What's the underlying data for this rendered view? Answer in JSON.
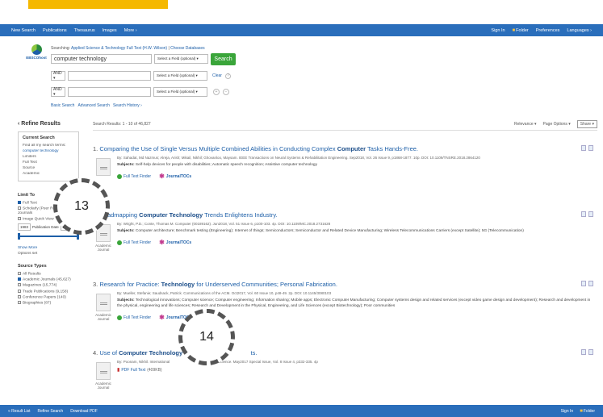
{
  "topbar": {
    "nav": [
      "New Search",
      "Publications",
      "Thesaurus",
      "Images",
      "More ›"
    ],
    "right": [
      "Sign In",
      "Folder",
      "Preferences",
      "Languages ›"
    ]
  },
  "logo_text": "EBSCOhost",
  "search": {
    "searching_label": "Searching:",
    "database": "Applied Science & Technology Full Text (H.W. Wilson)",
    "choose_db": "Choose Databases",
    "query": "computer technology",
    "field_select": "Select a Field (optional) ▾",
    "search_button": "Search",
    "bool2": "AND ▾",
    "bool3": "AND ▾",
    "clear": "Clear",
    "links": [
      "Basic Search",
      "Advanced Search",
      "Search History ›"
    ]
  },
  "sidebar": {
    "title": "Refine Results",
    "current_search": "Current Search",
    "find_all": "Find all my search terms:",
    "term": "computer technology",
    "limiters": "Limiters",
    "full_text": "Full Text",
    "source": "Source",
    "academic": "Academic",
    "limit_to": "Limit To",
    "lim_full_text": "Full Text",
    "lim_scholarly": "Scholarly (Peer Reviewed) Journals",
    "lim_image": "Image Quick View",
    "date_from": "1983",
    "date_label": "Publication Date",
    "date_to": "2018",
    "show_more": "Show More",
    "options_set": "Options set",
    "source_types": "Source Types",
    "all_results": "All Results",
    "src_academic": "Academic Journals (45,627)",
    "src_magazines": "Magazines (15,774)",
    "src_trade": "Trade Publications (9,158)",
    "src_conf": "Conference Papers (140)",
    "src_biographies": "Biographies (87)"
  },
  "results_bar": {
    "count": "Search Results: 1 - 10 of 46,827",
    "relevance": "Relevance ▾",
    "page_options": "Page Options ▾",
    "share": "Share ▾"
  },
  "results": [
    {
      "num": "1.",
      "title_pre": "Comparing the Use of Single Versus Multiple Combined Abilities in Conducting Complex ",
      "title_bold": "Computer",
      "title_post": " Tasks Hands-Free.",
      "meta": "By: Sahadat, Md Nazmus; Alreja, Arish; Mikail, Nikhil; Ghovanloo, Maysam. IEEE Transactions on Neural Systems & Rehabilitation Engineering. Sep2018, Vol. 26 Issue 9, p1868-1877. 10p. DOI: 10.1109/TNSRE.2018.2864120",
      "subjects_label": "Subjects:",
      "subjects": " Self-help devices for people with disabilities; Automatic speech recognition; Assistive computer technology",
      "thumb_label": "",
      "fulltext": "Full Text Finder",
      "tools": "JournalTOCs"
    },
    {
      "num": "2.",
      "title_pre": "Roadmapping ",
      "title_bold": "Computer Technology",
      "title_post": " Trends Enlightens Industry.",
      "meta": "By: Wright, P.D.; Conte, Thomas M. Computer (00189162). Jun2018, Vol. 51 Issue 6, p100-103. 4p. DOI: 10.1109/MC.2018.2731628",
      "subjects_label": "Subjects:",
      "subjects": " Computer architecture; Benchmark testing (Engineering); Internet of things; Semiconductors; Semiconductor and Related Device Manufacturing; Wireless Telecommunications Carriers (except Satellite); 5G (Telecommunication)",
      "thumb_label": "Academic Journal",
      "fulltext": "Full Text Finder",
      "tools": "JournalTOCs"
    },
    {
      "num": "3.",
      "title_pre": "Research for Practice: ",
      "title_bold": "Technology",
      "title_post": " for Underserved Communities; Personal Fabrication.",
      "meta": "By: Mueller, Stefanie; Saudsack, Patrick. Communications of the ACM. Oct2017, Vol. 60 Issue 10, p48-49. 2p. DOI: 10.1145/3080103",
      "subjects_label": "Subjects:",
      "subjects": " Technological innovations; Computer science; Computer engineering; Information sharing; Mobile apps; Electronic Computer Manufacturing; Computer systems design and related services (except video game design and development); Research and development in the physical, engineering and life sciences; Research and Development in the Physical, Engineering, and Life Sciences (except Biotechnology); Poor communities",
      "thumb_label": "Academic Journal",
      "fulltext": "Full Text Finder",
      "tools": "JournalTOCs"
    },
    {
      "num": "4.",
      "title_pre": "Use of ",
      "title_bold": "Computer Technology",
      "title_post": " fo",
      "title_tail": "ts.",
      "meta": "By: Poonam, Nikhil. International",
      "meta_tail": "Science. May2017 Special Issue, Vol. 8 Issue 4, p332-335. 4p",
      "pdf": "PDF Full Text",
      "pdf_size": "(409KB)",
      "thumb_label": "Academic Journal"
    }
  ],
  "callouts": [
    "13",
    "14"
  ],
  "footer": {
    "left": [
      "« Result List",
      "Refine Search",
      "Download PDF"
    ],
    "right": [
      "Sign In",
      "Folder"
    ]
  },
  "colors": {
    "topbar": "#2a6ebb",
    "accent": "#f5b800",
    "search_button": "#3aa53a",
    "link": "#1d5fa8"
  }
}
